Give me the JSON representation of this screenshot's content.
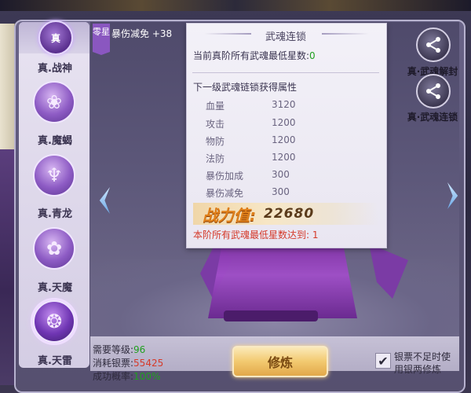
{
  "header": {
    "emblem_label": "真",
    "zero_tag_label": "零星",
    "bonus_label": "暴伤减免 +38"
  },
  "sidebar": {
    "items": [
      {
        "label": "真.战神",
        "active": false
      },
      {
        "label": "真.魔蝎",
        "active": false
      },
      {
        "label": "真.青龙",
        "active": false
      },
      {
        "label": "真.天魔",
        "active": false
      },
      {
        "label": "真.天雷",
        "active": true
      }
    ]
  },
  "popup": {
    "title": "武魂连锁",
    "current_min_star_label": "当前真阶所有武魂最低星数:",
    "current_min_star_value": "0",
    "next_level_label": "下一级武魂链锁获得属性",
    "stats": [
      {
        "name": "血量",
        "value": "3120"
      },
      {
        "name": "攻击",
        "value": "1200"
      },
      {
        "name": "物防",
        "value": "1200"
      },
      {
        "name": "法防",
        "value": "1200"
      },
      {
        "name": "暴伤加成",
        "value": "300"
      },
      {
        "name": "暴伤减免",
        "value": "300"
      }
    ],
    "power_label": "战力值:",
    "power_value": "22680",
    "requirement_text": "本阶所有武魂最低星数达到: 1"
  },
  "right_buttons": [
    {
      "label": "真·武魂解封",
      "icon": "chain-node-icon"
    },
    {
      "label": "真·武魂连锁",
      "icon": "chain-link-icon"
    }
  ],
  "bottom": {
    "req_level_label": "需要等级:",
    "req_level_value": "96",
    "cost_label": "消耗银票:",
    "cost_value": "55425",
    "success_label": "成功概率:",
    "success_value": "100%",
    "cultivate_label": "修炼",
    "checkbox_line1": "银票不足时使",
    "checkbox_line2": "用银两修炼",
    "checkbox_checked": true
  },
  "colors": {
    "accent_purple": "#8a57c0",
    "power_orange": "#e0801a",
    "warn_red": "#d53a2a",
    "ok_green": "#20a020",
    "button_gold": "#f2c96f"
  }
}
